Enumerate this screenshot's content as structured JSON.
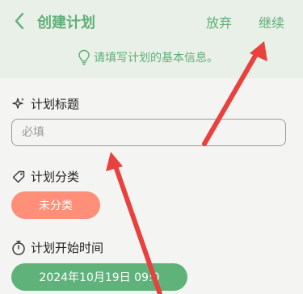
{
  "header": {
    "back_icon": "chevron-left-icon",
    "title": "创建计划",
    "abandon_label": "放弃",
    "continue_label": "继续",
    "hint": "请填写计划的基本信息。",
    "hint_icon": "lightbulb-icon"
  },
  "form": {
    "title_section": {
      "icon": "sparkle-icon",
      "label": "计划标题",
      "placeholder": "必填",
      "value": ""
    },
    "category_section": {
      "icon": "tag-icon",
      "label": "计划分类",
      "selected": "未分类"
    },
    "start_section": {
      "icon": "stopwatch-icon",
      "label": "计划开始时间",
      "value": "2024年10月19日 09:0"
    }
  },
  "colors": {
    "accent_green": "#5fae78",
    "header_bg": "#e8f0e8",
    "category_pill": "#ff8f78",
    "date_pill": "#5fb27a",
    "annotation_arrow": "#e8413e"
  }
}
